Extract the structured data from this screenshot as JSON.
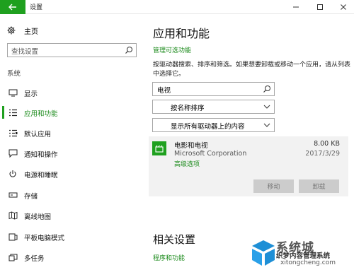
{
  "window": {
    "title": "设置"
  },
  "sidebar": {
    "home_label": "主页",
    "search_placeholder": "查找设置",
    "section_label": "系统",
    "items": [
      {
        "label": "显示",
        "icon": "monitor-icon"
      },
      {
        "label": "应用和功能",
        "icon": "apps-list-icon",
        "active": true
      },
      {
        "label": "默认应用",
        "icon": "default-apps-icon"
      },
      {
        "label": "通知和操作",
        "icon": "notifications-icon"
      },
      {
        "label": "电源和睡眠",
        "icon": "power-icon"
      },
      {
        "label": "存储",
        "icon": "storage-icon"
      },
      {
        "label": "离线地图",
        "icon": "map-icon"
      },
      {
        "label": "平板电脑模式",
        "icon": "tablet-icon"
      },
      {
        "label": "多任务",
        "icon": "multitask-icon"
      }
    ]
  },
  "main": {
    "title": "应用和功能",
    "manage_optional_link": "管理可选功能",
    "description": "按驱动器搜索、排序和筛选。如果想要卸载或移动一个应用，请从列表中选择它。",
    "search_value": "电视",
    "sort_dropdown": "按名称排序",
    "drive_dropdown": "显示所有驱动器上的内容",
    "app": {
      "name": "电影和电视",
      "publisher": "Microsoft Corporation",
      "advanced_link": "高级选项",
      "size": "8.00 KB",
      "date": "2017/3/29",
      "move_label": "移动",
      "uninstall_label": "卸载"
    },
    "related_title": "相关设置",
    "programs_link": "程序和功能"
  },
  "watermark": {
    "text": "系统城",
    "subtitle": "织梦内容管理系统",
    "url": "xitongcheng.com"
  },
  "colors": {
    "accent": "#1fa01f",
    "link": "#1a8a1a",
    "card_bg": "#f2f2f2",
    "button_disabled": "#cccccc"
  }
}
